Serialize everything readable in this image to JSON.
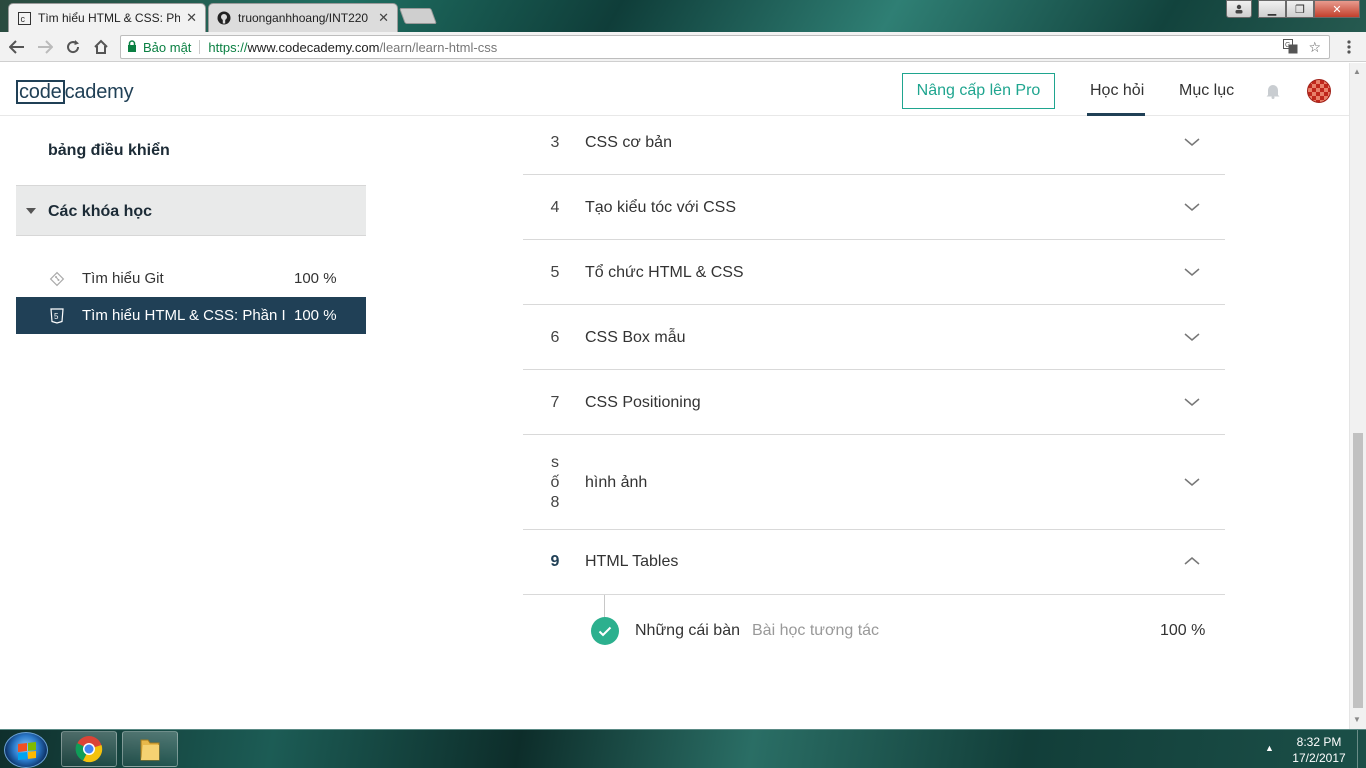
{
  "browser": {
    "tabs": [
      {
        "title": "Tìm hiểu HTML & CSS: Ph",
        "favicon": "codecademy-icon",
        "active": true
      },
      {
        "title": "truonganhhoang/INT220",
        "favicon": "github-icon",
        "active": false
      }
    ],
    "address_bar": {
      "security_label": "Bảo mật",
      "url_scheme": "https://",
      "url_host": "www.codecademy.com",
      "url_path": "/learn/learn-html-css"
    }
  },
  "header": {
    "logo_left": "code",
    "logo_right": "cademy",
    "upgrade_label": "Nâng cấp lên Pro",
    "nav_learn": "Học hỏi",
    "nav_catalog": "Mục lục"
  },
  "sidebar": {
    "dashboard_label": "bảng điều khiển",
    "courses_label": "Các khóa học",
    "courses": [
      {
        "title": "Tìm hiểu Git",
        "percent": "100 %",
        "icon": "git-icon",
        "selected": false
      },
      {
        "title": "Tìm hiểu HTML & CSS: Phần I",
        "percent": "100 %",
        "icon": "html5-icon",
        "selected": true
      }
    ]
  },
  "syllabus": {
    "units": [
      {
        "number": "3",
        "title": "CSS cơ bản",
        "expanded": false
      },
      {
        "number": "4",
        "title": "Tạo kiểu tóc với CSS",
        "expanded": false
      },
      {
        "number": "5",
        "title": "Tổ chức HTML & CSS",
        "expanded": false
      },
      {
        "number": "6",
        "title": "CSS Box mẫu",
        "expanded": false
      },
      {
        "number": "7",
        "title": "CSS Positioning",
        "expanded": false
      },
      {
        "number_lines": [
          "s",
          "ố",
          "8"
        ],
        "title": "hình ảnh",
        "expanded": false
      },
      {
        "number": "9",
        "title": "HTML Tables",
        "expanded": true
      }
    ],
    "lesson": {
      "title": "Những cái bàn",
      "type": "Bài học tương tác",
      "percent": "100 %"
    }
  },
  "taskbar": {
    "time": "8:32 PM",
    "date": "17/2/2017"
  },
  "colors": {
    "navy": "#204056",
    "teal": "#1fa58f",
    "check_green": "#2cb08e"
  }
}
